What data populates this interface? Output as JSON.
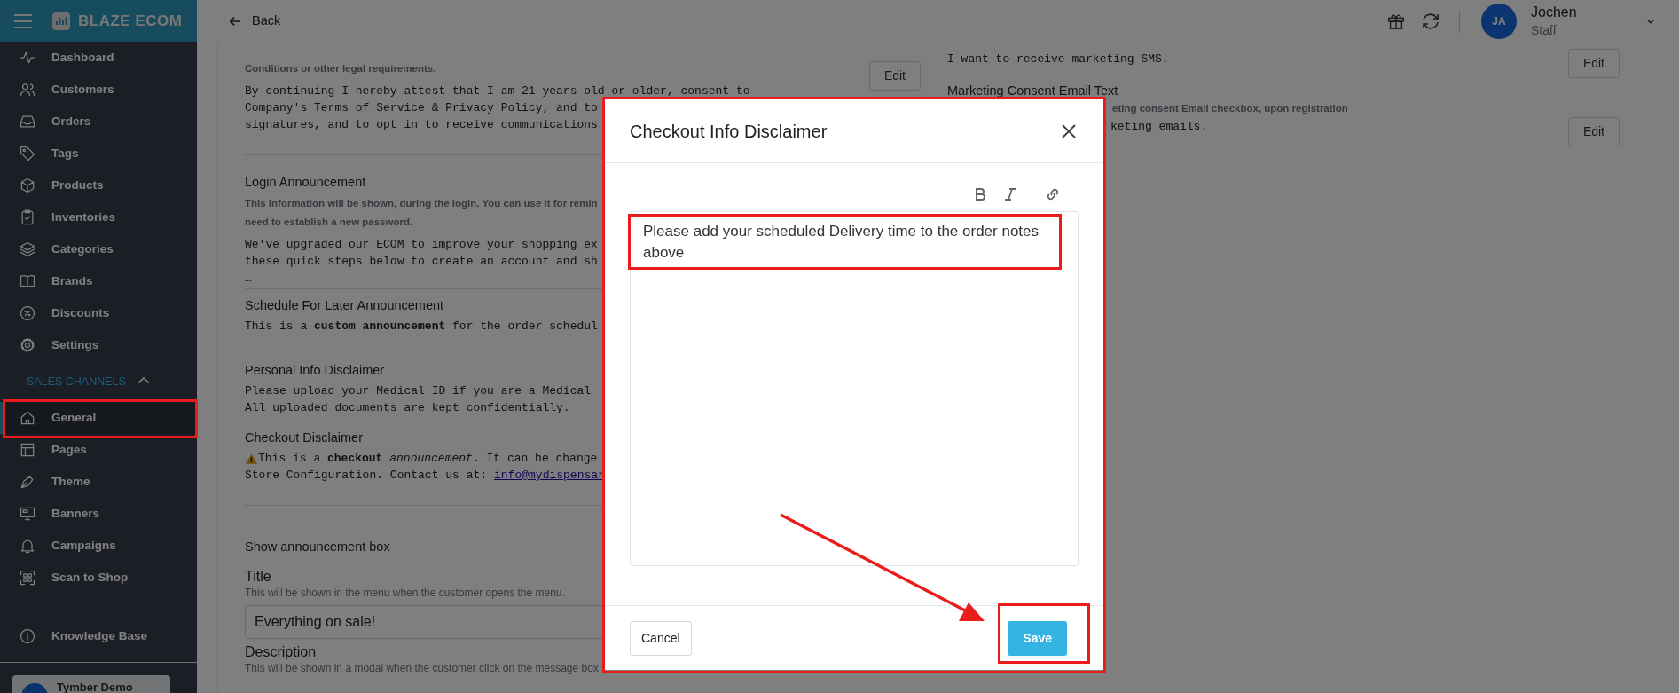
{
  "sidebar": {
    "brand": "BLAZE ECOM",
    "items": [
      {
        "label": "Dashboard",
        "selected": false
      },
      {
        "label": "Customers",
        "selected": false
      },
      {
        "label": "Orders",
        "selected": false
      },
      {
        "label": "Tags",
        "selected": false
      },
      {
        "label": "Products",
        "selected": false
      },
      {
        "label": "Inventories",
        "selected": false
      },
      {
        "label": "Categories",
        "selected": false
      },
      {
        "label": "Brands",
        "selected": false
      },
      {
        "label": "Discounts",
        "selected": false
      },
      {
        "label": "Settings",
        "selected": false
      }
    ],
    "section": {
      "label": "SALES CHANNELS",
      "expanded": true
    },
    "channel_items": [
      {
        "label": "General",
        "selected": true
      },
      {
        "label": "Pages",
        "selected": false
      },
      {
        "label": "Theme",
        "selected": false
      },
      {
        "label": "Banners",
        "selected": false
      },
      {
        "label": "Campaigns",
        "selected": false
      },
      {
        "label": "Scan to Shop",
        "selected": false
      }
    ],
    "footer_item": {
      "label": "Knowledge Base"
    },
    "account": {
      "label": "Tymber Demo"
    }
  },
  "topbar": {
    "back": "Back",
    "user": {
      "initials": "JA",
      "name": "Jochen",
      "role": "Staff"
    }
  },
  "left_settings": [
    {
      "hint_lines": [
        "Conditions or other legal requirements."
      ],
      "value_lines": [
        "By continuing I hereby attest that I am 21 years old or older, consent to",
        "Company's Terms of Service & Privacy Policy, and to",
        "signatures, and to opt in to receive communications"
      ],
      "edit": "Edit"
    },
    {
      "title": "Login Announcement",
      "hint_lines": [
        "This information will be shown, during the login. You can use it for remin",
        "need to establish a new password."
      ],
      "value_lines": [
        "We've upgraded our ECOM to improve your shopping ex",
        "these quick steps below to create an account and sh",
        "…"
      ]
    },
    {
      "title": "Schedule For Later Announcement",
      "value_lines": [
        "This is a **custom announcement** for the order schedul"
      ]
    },
    {
      "title": "Personal Info Disclaimer",
      "value_lines": [
        "Please upload your Medical ID if you are a Medical",
        "All uploaded documents are kept confidentially."
      ]
    },
    {
      "title": "Checkout Disclaimer",
      "warning": true,
      "value_lines": [
        "This is a **checkout** *announcement*. It can be change",
        "Store Configuration. Contact us at:"
      ],
      "link": "info@mydispensar"
    }
  ],
  "announcement": {
    "label": "Show announcement box",
    "title_field": {
      "label": "Title",
      "hint": "This will be shown in the menu when the customer opens the menu.",
      "value": "Everything on sale!"
    },
    "description_field": {
      "label": "Description",
      "hint": "This will be shown in a modal when the customer click on the message box"
    }
  },
  "right_settings": [
    {
      "value": "I want to receive marketing SMS.",
      "edit": "Edit"
    },
    {
      "title": "Marketing Consent Email Text",
      "hint": "eting consent Email checkbox, upon registration",
      "value": "keting emails.",
      "edit": "Edit"
    }
  ],
  "modal": {
    "title": "Checkout Info Disclaimer",
    "text": "Please add your scheduled Delivery time to the order notes above",
    "cancel": "Cancel",
    "save": "Save"
  }
}
